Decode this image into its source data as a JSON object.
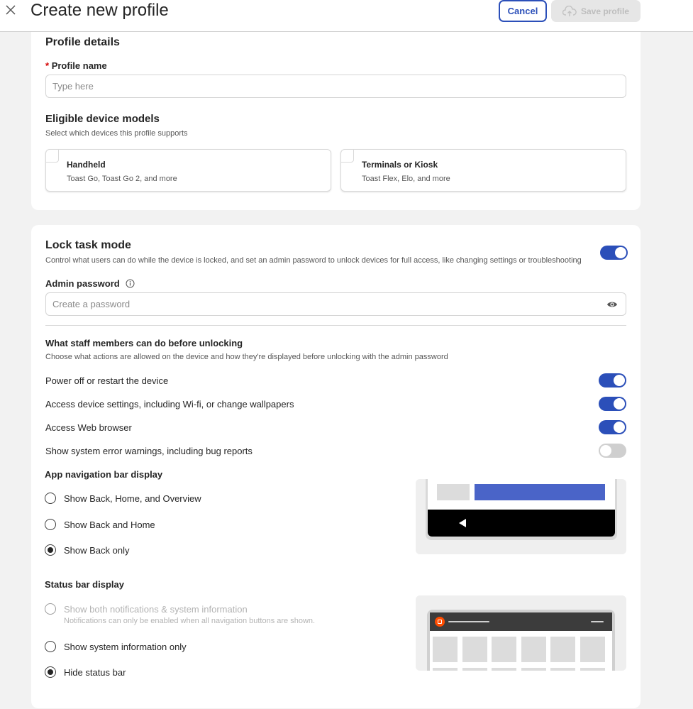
{
  "header": {
    "title": "Create new profile",
    "cancel_label": "Cancel",
    "save_label": "Save profile"
  },
  "profile_details": {
    "heading": "Profile details",
    "required_mark": "*",
    "name_label": "Profile name",
    "name_placeholder": "Type here",
    "name_value": ""
  },
  "eligible_devices": {
    "heading": "Eligible device models",
    "subtitle": "Select which devices this profile supports",
    "options": [
      {
        "title": "Handheld",
        "subtitle": "Toast Go, Toast Go 2, and more",
        "checked": false
      },
      {
        "title": "Terminals or Kiosk",
        "subtitle": "Toast Flex, Elo, and more",
        "checked": false
      }
    ]
  },
  "lock_task": {
    "heading": "Lock task mode",
    "description": "Control what users can do while the device is locked, and set an admin password to unlock devices for full access, like changing settings or troubleshooting",
    "enabled": true,
    "password_label": "Admin password",
    "password_placeholder": "Create a password",
    "password_value": ""
  },
  "staff_actions": {
    "heading": "What staff members can do before unlocking",
    "subtitle": "Choose what actions are allowed on the device and how they're displayed before unlocking with the admin password",
    "items": [
      {
        "label": "Power off or restart the device",
        "enabled": true
      },
      {
        "label": "Access device settings, including Wi-fi, or change wallpapers",
        "enabled": true
      },
      {
        "label": "Access Web browser",
        "enabled": true
      },
      {
        "label": "Show system error warnings, including bug reports",
        "enabled": false
      }
    ]
  },
  "nav_bar": {
    "heading": "App navigation bar display",
    "options": [
      {
        "label": "Show Back, Home, and Overview",
        "selected": false
      },
      {
        "label": "Show Back and Home",
        "selected": false
      },
      {
        "label": "Show Back only",
        "selected": true
      }
    ]
  },
  "status_bar": {
    "heading": "Status bar display",
    "options": [
      {
        "label": "Show both notifications & system information",
        "note": "Notifications can only be enabled when all navigation buttons are shown.",
        "selected": false,
        "disabled": true
      },
      {
        "label": "Show system information only",
        "selected": false,
        "disabled": false
      },
      {
        "label": "Hide status bar",
        "selected": true,
        "disabled": false
      }
    ]
  },
  "colors": {
    "accent": "#2b4fb9",
    "illustration_blue": "#4a64c8",
    "toast_orange": "#ff4c00"
  },
  "icons": {
    "close": "close-icon",
    "upload": "cloud-upload-icon",
    "info": "info-icon",
    "eye": "eye-icon",
    "back": "back-triangle-icon"
  }
}
